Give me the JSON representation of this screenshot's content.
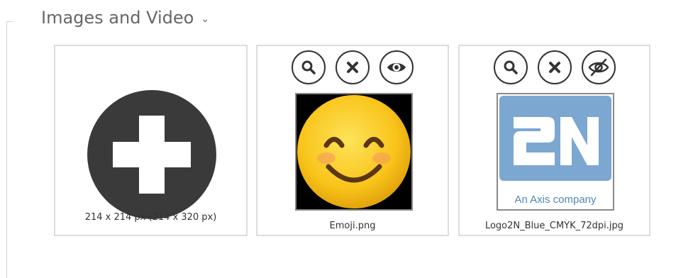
{
  "section": {
    "title": "Images and Video",
    "expand_icon": "chevron-down-icon"
  },
  "tiles": {
    "add": {
      "icon": "plus-circle-icon",
      "caption": "214 x 214 px (214 x 320 px)"
    },
    "emoji": {
      "caption": "Emoji.png",
      "buttons": [
        "zoom-icon",
        "remove-icon",
        "eye-icon"
      ]
    },
    "logo": {
      "caption": "Logo2N_Blue_CMYK_72dpi.jpg",
      "buttons": [
        "zoom-icon",
        "remove-icon",
        "eye-off-icon"
      ],
      "logo_text": "2N",
      "logo_tagline": "An Axis company"
    }
  },
  "colors": {
    "logo_blue": "#7ba7d1",
    "emoji_yellow": "#f9c41a",
    "add_circle": "#3a3a3a",
    "border": "#dcdcdc"
  }
}
